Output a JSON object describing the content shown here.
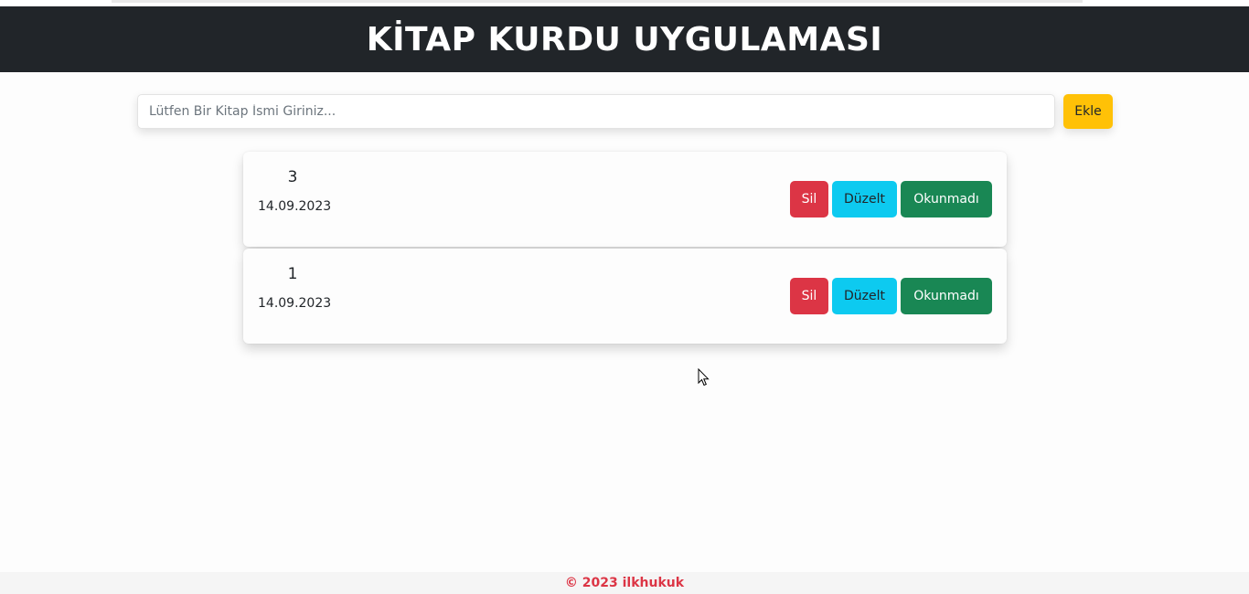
{
  "header": {
    "title": "KİTAP KURDU UYGULAMASI"
  },
  "search": {
    "placeholder": "Lütfen Bir Kitap İsmi Giriniz...",
    "value": "",
    "add_label": "Ekle"
  },
  "books": [
    {
      "title": "3",
      "date": "14.09.2023",
      "delete_label": "Sil",
      "edit_label": "Düzelt",
      "status_label": "Okunmadı"
    },
    {
      "title": "1",
      "date": "14.09.2023",
      "delete_label": "Sil",
      "edit_label": "Düzelt",
      "status_label": "Okunmadı"
    }
  ],
  "footer": {
    "text": "© 2023 ilkhukuk"
  },
  "colors": {
    "header_bg": "#212529",
    "add_button": "#ffc107",
    "delete_button": "#dc3545",
    "edit_button": "#0dcaf0",
    "status_button": "#198754",
    "footer_text": "#dc3545"
  }
}
